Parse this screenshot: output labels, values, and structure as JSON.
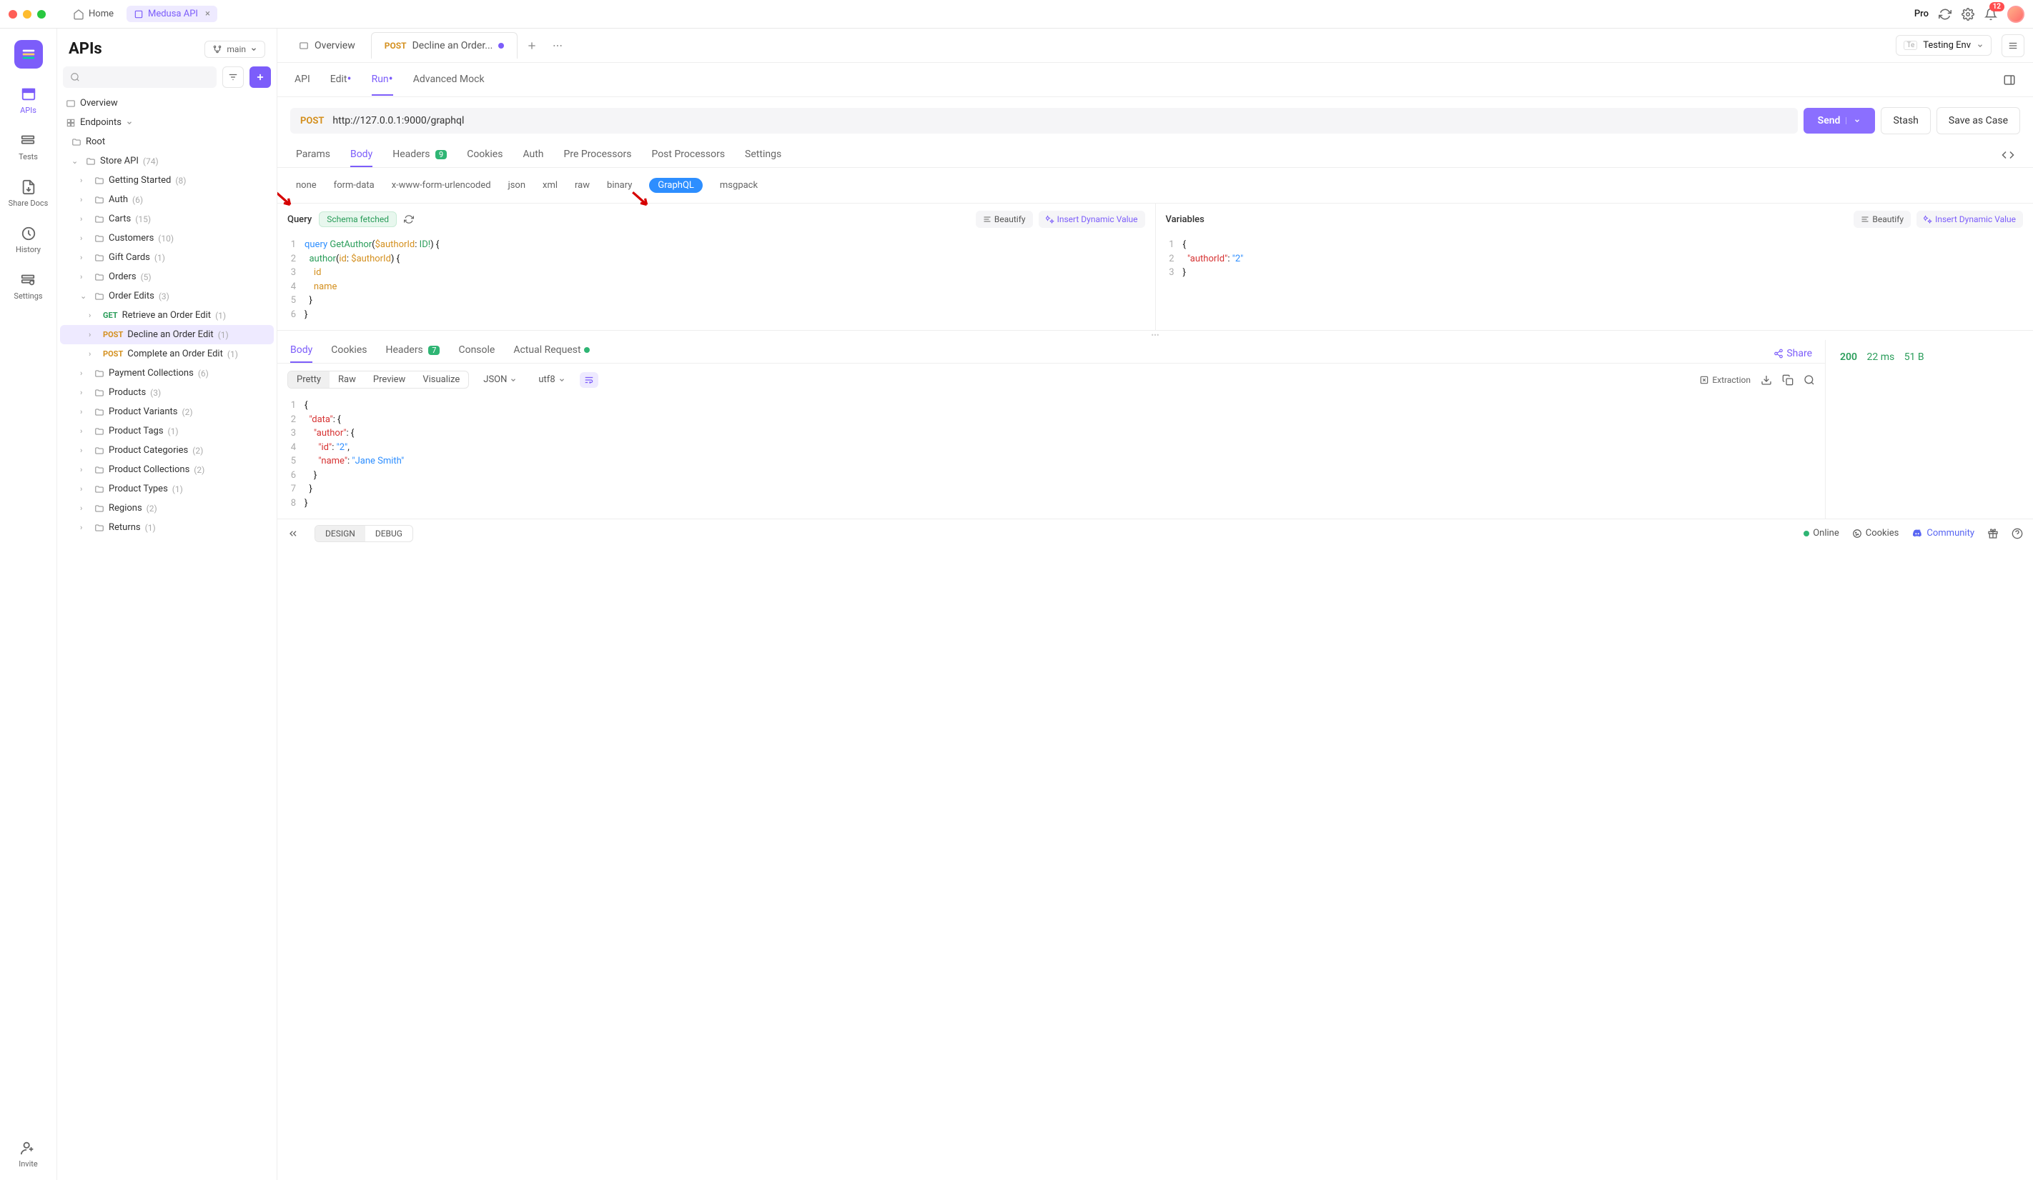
{
  "titlebar": {
    "home_tab": "Home",
    "active_tab": "Medusa API",
    "pro": "Pro",
    "notification_count": "12"
  },
  "rail": {
    "items": [
      {
        "label": "APIs",
        "active": true
      },
      {
        "label": "Tests"
      },
      {
        "label": "Share Docs"
      },
      {
        "label": "History"
      },
      {
        "label": "Settings"
      }
    ],
    "invite": "Invite"
  },
  "sidebar": {
    "title": "APIs",
    "branch": "main",
    "overview": "Overview",
    "endpoints": "Endpoints",
    "root": "Root",
    "folders": [
      {
        "name": "Store API",
        "count": "(74)",
        "open": true,
        "children": [
          {
            "name": "Getting Started",
            "count": "(8)"
          },
          {
            "name": "Auth",
            "count": "(6)"
          },
          {
            "name": "Carts",
            "count": "(15)"
          },
          {
            "name": "Customers",
            "count": "(10)"
          },
          {
            "name": "Gift Cards",
            "count": "(1)"
          },
          {
            "name": "Orders",
            "count": "(5)"
          },
          {
            "name": "Order Edits",
            "count": "(3)",
            "open": true,
            "children": [
              {
                "method": "GET",
                "name": "Retrieve an Order Edit",
                "count": "(1)"
              },
              {
                "method": "POST",
                "name": "Decline an Order Edit",
                "count": "(1)",
                "selected": true
              },
              {
                "method": "POST",
                "name": "Complete an Order Edit",
                "count": "(1)"
              }
            ]
          },
          {
            "name": "Payment Collections",
            "count": "(6)"
          },
          {
            "name": "Products",
            "count": "(3)"
          },
          {
            "name": "Product Variants",
            "count": "(2)"
          },
          {
            "name": "Product Tags",
            "count": "(1)"
          },
          {
            "name": "Product Categories",
            "count": "(2)"
          },
          {
            "name": "Product Collections",
            "count": "(2)"
          },
          {
            "name": "Product Types",
            "count": "(1)"
          },
          {
            "name": "Regions",
            "count": "(2)"
          },
          {
            "name": "Returns",
            "count": "(1)"
          }
        ]
      }
    ]
  },
  "content_tabs": {
    "overview_tab": "Overview",
    "active_tab_method": "POST",
    "active_tab_title": "Decline an Order...",
    "env_prefix": "Te",
    "env": "Testing Env"
  },
  "subtabs": {
    "api": "API",
    "edit": "Edit",
    "run": "Run",
    "mock": "Advanced Mock"
  },
  "urlbar": {
    "method": "POST",
    "url": "http://127.0.0.1:9000/graphql",
    "send": "Send",
    "stash": "Stash",
    "save_as_case": "Save as Case"
  },
  "request_tabs": {
    "params": "Params",
    "body": "Body",
    "headers": "Headers",
    "headers_count": "9",
    "cookies": "Cookies",
    "auth": "Auth",
    "pre": "Pre Processors",
    "post": "Post Processors",
    "settings": "Settings"
  },
  "body_types": {
    "none": "none",
    "form": "form-data",
    "xwww": "x-www-form-urlencoded",
    "json": "json",
    "xml": "xml",
    "raw": "raw",
    "binary": "binary",
    "graphql": "GraphQL",
    "msgpack": "msgpack"
  },
  "query_pane": {
    "title": "Query",
    "schema_fetched": "Schema fetched",
    "beautify": "Beautify",
    "insert": "Insert Dynamic Value",
    "lines": [
      "query GetAuthor($authorId: ID!) {",
      "  author(id: $authorId) {",
      "    id",
      "    name",
      "  }",
      "}"
    ]
  },
  "vars_pane": {
    "title": "Variables",
    "beautify": "Beautify",
    "insert": "Insert Dynamic Value",
    "lines": [
      "{",
      "  \"authorId\": \"2\"",
      "}"
    ]
  },
  "response": {
    "tabs": {
      "body": "Body",
      "cookies": "Cookies",
      "headers": "Headers",
      "headers_count": "7",
      "console": "Console",
      "actual": "Actual Request"
    },
    "share": "Share",
    "status": "200",
    "time": "22 ms",
    "size": "51 B",
    "view_modes": {
      "pretty": "Pretty",
      "raw": "Raw",
      "preview": "Preview",
      "visualize": "Visualize",
      "json": "JSON",
      "utf8": "utf8"
    },
    "extraction": "Extraction",
    "lines": [
      "{",
      "  \"data\": {",
      "    \"author\": {",
      "      \"id\": \"2\",",
      "      \"name\": \"Jane Smith\"",
      "    }",
      "  }",
      "}"
    ]
  },
  "bottombar": {
    "design": "DESIGN",
    "debug": "DEBUG",
    "online": "Online",
    "cookies": "Cookies",
    "community": "Community"
  }
}
